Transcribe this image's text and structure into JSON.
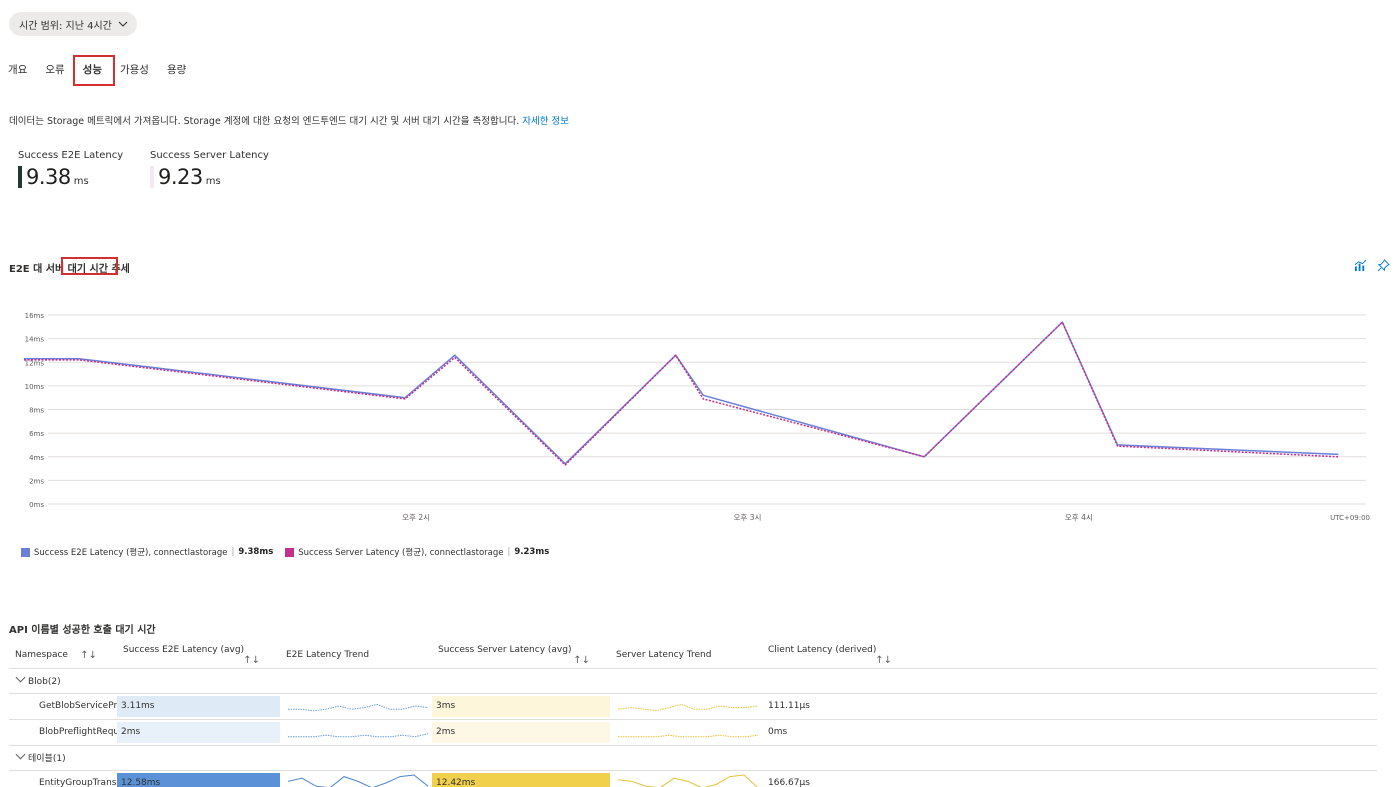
{
  "time_range": {
    "label": "시간 범위: 지난 4시간"
  },
  "tabs": [
    {
      "label": "개요"
    },
    {
      "label": "오류"
    },
    {
      "label": "성능",
      "active": true
    },
    {
      "label": "가용성"
    },
    {
      "label": "용량"
    }
  ],
  "description": {
    "text": "데이터는 Storage 메트릭에서 가져옵니다. Storage 계정에 대한 요청의 엔드투엔드 대기 시간 및 서버 대기 시간을 측정합니다.",
    "link": "자세한 정보"
  },
  "kpis": [
    {
      "label": "Success E2E Latency",
      "value": "9.38",
      "unit": "ms",
      "color": "#1f3b2c"
    },
    {
      "label": "Success Server Latency",
      "value": "9.23",
      "unit": "ms",
      "color": "#f3e9f0"
    }
  ],
  "chart_section": {
    "title_before": "E2E 대 서버 ",
    "title_highlight": "대기 시간",
    "title_after": " 추세"
  },
  "chart_data": {
    "type": "line",
    "x": [
      "12:52",
      "13:07",
      "13:22",
      "13:37",
      "13:52",
      "14:07",
      "14:22",
      "14:37",
      "14:52",
      "15:07",
      "15:22",
      "15:37",
      "15:52",
      "16:07",
      "16:22",
      "16:37",
      "16:52"
    ],
    "x_ticks": [
      {
        "label": "오후 2시",
        "pos": "14:00"
      },
      {
        "label": "오후 3시",
        "pos": "15:00"
      },
      {
        "label": "오후 4시",
        "pos": "16:00"
      }
    ],
    "timezone_label": "UTC+09:00",
    "ylim": [
      0,
      16
    ],
    "y_ticks": [
      "0ms",
      "2ms",
      "4ms",
      "6ms",
      "8ms",
      "10ms",
      "12ms",
      "14ms",
      "16ms"
    ],
    "grid": true,
    "series": [
      {
        "name": "Success E2E Latency (평균), connectlastorage",
        "summary": "9.38ms",
        "color": "#6b7fd7",
        "points": [
          [
            "12:49",
            12.3
          ],
          [
            "12:59",
            12.3
          ],
          [
            "13:58",
            9.0
          ],
          [
            "14:07",
            12.6
          ],
          [
            "14:27",
            3.4
          ],
          [
            "14:47",
            12.6
          ],
          [
            "14:52",
            9.2
          ],
          [
            "15:32",
            4.0
          ],
          [
            "15:57",
            15.4
          ],
          [
            "16:07",
            5.0
          ],
          [
            "16:47",
            4.2
          ]
        ]
      },
      {
        "name": "Success Server Latency (평균), connectlastorage",
        "summary": "9.23ms",
        "color": "#c2318b",
        "points": [
          [
            "12:49",
            12.2
          ],
          [
            "12:59",
            12.2
          ],
          [
            "13:58",
            8.9
          ],
          [
            "14:07",
            12.4
          ],
          [
            "14:27",
            3.3
          ],
          [
            "14:47",
            12.6
          ],
          [
            "14:52",
            8.9
          ],
          [
            "15:32",
            4.0
          ],
          [
            "15:57",
            15.4
          ],
          [
            "16:07",
            4.9
          ],
          [
            "16:47",
            4.0
          ]
        ]
      }
    ]
  },
  "table_section": {
    "title": "API 이름별 성공한 호출 대기 시간",
    "columns": [
      "Namespace",
      "Success E2E Latency (avg)",
      "E2E Latency Trend",
      "Success Server Latency (avg)",
      "Server Latency Trend",
      "Client Latency (derived)"
    ],
    "groups": [
      {
        "label": "Blob(2)",
        "rows": [
          {
            "name": "GetBlobServicePr",
            "e2e": "3.11ms",
            "e2e_frac": 1.0,
            "server": "3ms",
            "server_frac": 1.0,
            "client": "111.11µs",
            "e2e_bg": "#deebf7",
            "server_bg": "#fdf6da",
            "e2e_trend": [
              0.3,
              0.3,
              0.2,
              0.3,
              0.5,
              0.3,
              0.4,
              0.6,
              0.3,
              0.3,
              0.5,
              0.4
            ],
            "server_trend": [
              0.3,
              0.4,
              0.3,
              0.2,
              0.4,
              0.6,
              0.3,
              0.3,
              0.5,
              0.4,
              0.4,
              0.5
            ]
          },
          {
            "name": "BlobPreflightRequ",
            "e2e": "2ms",
            "e2e_frac": 1.0,
            "server": "2ms",
            "server_frac": 1.0,
            "client": "0ms",
            "e2e_bg": "#e8f1fa",
            "server_bg": "#fdf8e6",
            "e2e_trend": [
              0.2,
              0.2,
              0.2,
              0.3,
              0.2,
              0.2,
              0.3,
              0.2,
              0.2,
              0.3,
              0.2,
              0.4
            ],
            "server_trend": [
              0.2,
              0.2,
              0.2,
              0.2,
              0.3,
              0.2,
              0.2,
              0.2,
              0.3,
              0.2,
              0.2,
              0.3
            ]
          }
        ]
      },
      {
        "label": "테이블(1)",
        "rows": [
          {
            "name": "EntityGroupTrans:",
            "e2e": "12.58ms",
            "e2e_frac": 1.0,
            "server": "12.42ms",
            "server_frac": 1.0,
            "client": "166.67µs",
            "e2e_bg": "#5b91d6",
            "server_bg": "#f1d04b",
            "e2e_trend": [
              0.6,
              0.8,
              0.3,
              0.2,
              0.9,
              0.6,
              0.2,
              0.5,
              0.9,
              1.0,
              0.3
            ],
            "server_trend": [
              0.7,
              0.6,
              0.3,
              0.2,
              0.8,
              0.6,
              0.2,
              0.4,
              0.9,
              1.0,
              0.2
            ]
          }
        ]
      }
    ]
  },
  "icons": {
    "dropdown": "chevron-down-icon",
    "metrics": "metrics-chart-icon",
    "pin": "pin-icon"
  }
}
